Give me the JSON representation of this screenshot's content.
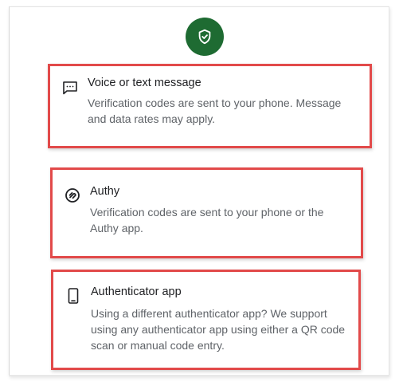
{
  "header": {
    "icon": "shield-check-icon",
    "accent_color": "#1e6b32"
  },
  "highlight_color": "#e24a4a",
  "options": [
    {
      "icon": "message-dots-icon",
      "title": "Voice or text message",
      "description": "Verification codes are sent to your phone. Message and data rates may apply."
    },
    {
      "icon": "authy-icon",
      "title": "Authy",
      "description": "Verification codes are sent to your phone or the Authy app."
    },
    {
      "icon": "smartphone-icon",
      "title": "Authenticator app",
      "description": "Using a different authenticator app? We support using any authenticator app using either a QR code scan or manual code entry."
    }
  ]
}
